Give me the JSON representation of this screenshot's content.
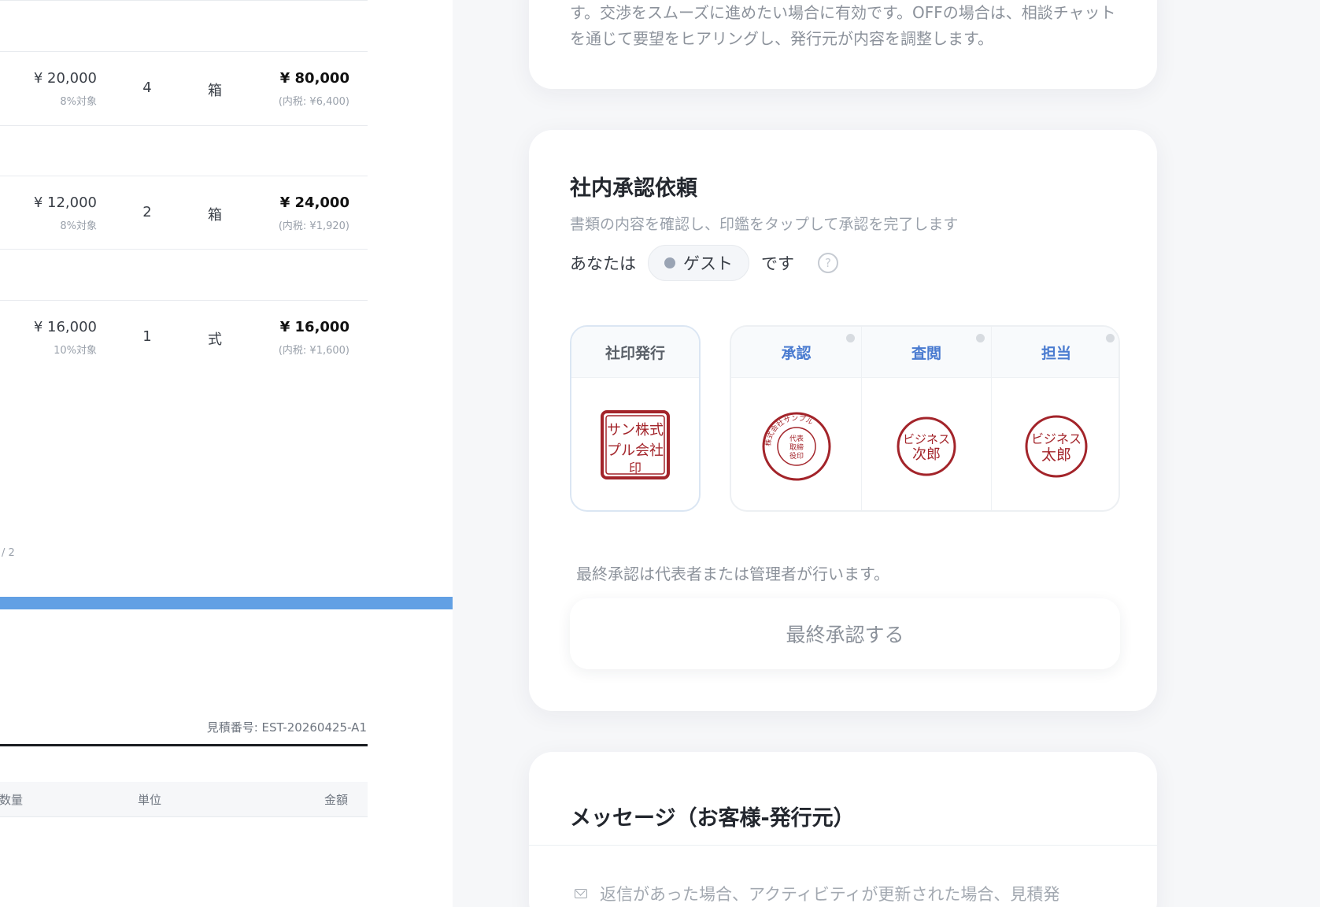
{
  "items": [
    {
      "unit_price": "¥ 20,000",
      "tax_rate": "8%対象",
      "qty": "4",
      "unit": "箱",
      "amount": "¥ 80,000",
      "inner_tax": "(内税: ¥6,400)"
    },
    {
      "unit_price": "¥ 12,000",
      "tax_rate": "8%対象",
      "qty": "2",
      "unit": "箱",
      "amount": "¥ 24,000",
      "inner_tax": "(内税: ¥1,920)"
    },
    {
      "unit_price": "¥ 16,000",
      "tax_rate": "10%対象",
      "qty": "1",
      "unit": "式",
      "amount": "¥ 16,000",
      "inner_tax": "(内税: ¥1,600)"
    }
  ],
  "document": {
    "page_indicator": "/ 2",
    "estimate_number": "見積番号: EST-20260425-A1",
    "table_header": {
      "qty": "数量",
      "unit": "単位",
      "amount": "金額"
    }
  },
  "negotiation_card": {
    "text": "す。交渉をスムーズに進めたい場合に有効です。OFFの場合は、相談チャットを通じて要望をヒアリングし、発行元が内容を調整します。"
  },
  "approval_card": {
    "title": "社内承認依頼",
    "subtitle": "書類の内容を確認し、印鑑をタップして承認を完了します",
    "you_prefix": "あなたは",
    "role": "ゲスト",
    "you_suffix": "です",
    "help": "?",
    "company_seal": {
      "label": "社印発行",
      "seal_text": [
        "株式",
        "会社",
        "サン",
        "プル",
        "印"
      ]
    },
    "approvals": [
      {
        "label": "承認",
        "seal_lines": [
          "代表",
          "取締",
          "役印"
        ],
        "ring_text": "株式会社サンプル"
      },
      {
        "label": "査閲",
        "seal_lines": [
          "ビジネス",
          "次郎"
        ]
      },
      {
        "label": "担当",
        "seal_lines": [
          "ビジネス",
          "太郎"
        ]
      }
    ],
    "final_note": "最終承認は代表者または管理者が行います。",
    "final_button": "最終承認する"
  },
  "message_card": {
    "title": "メッセージ（お客様-発行元）",
    "notice": "返信があった場合、アクティビティが更新された場合、見積発"
  },
  "colors": {
    "accent": "#62a0e4",
    "seal_red": "#a3242a",
    "link_blue": "#4a7bd0"
  }
}
